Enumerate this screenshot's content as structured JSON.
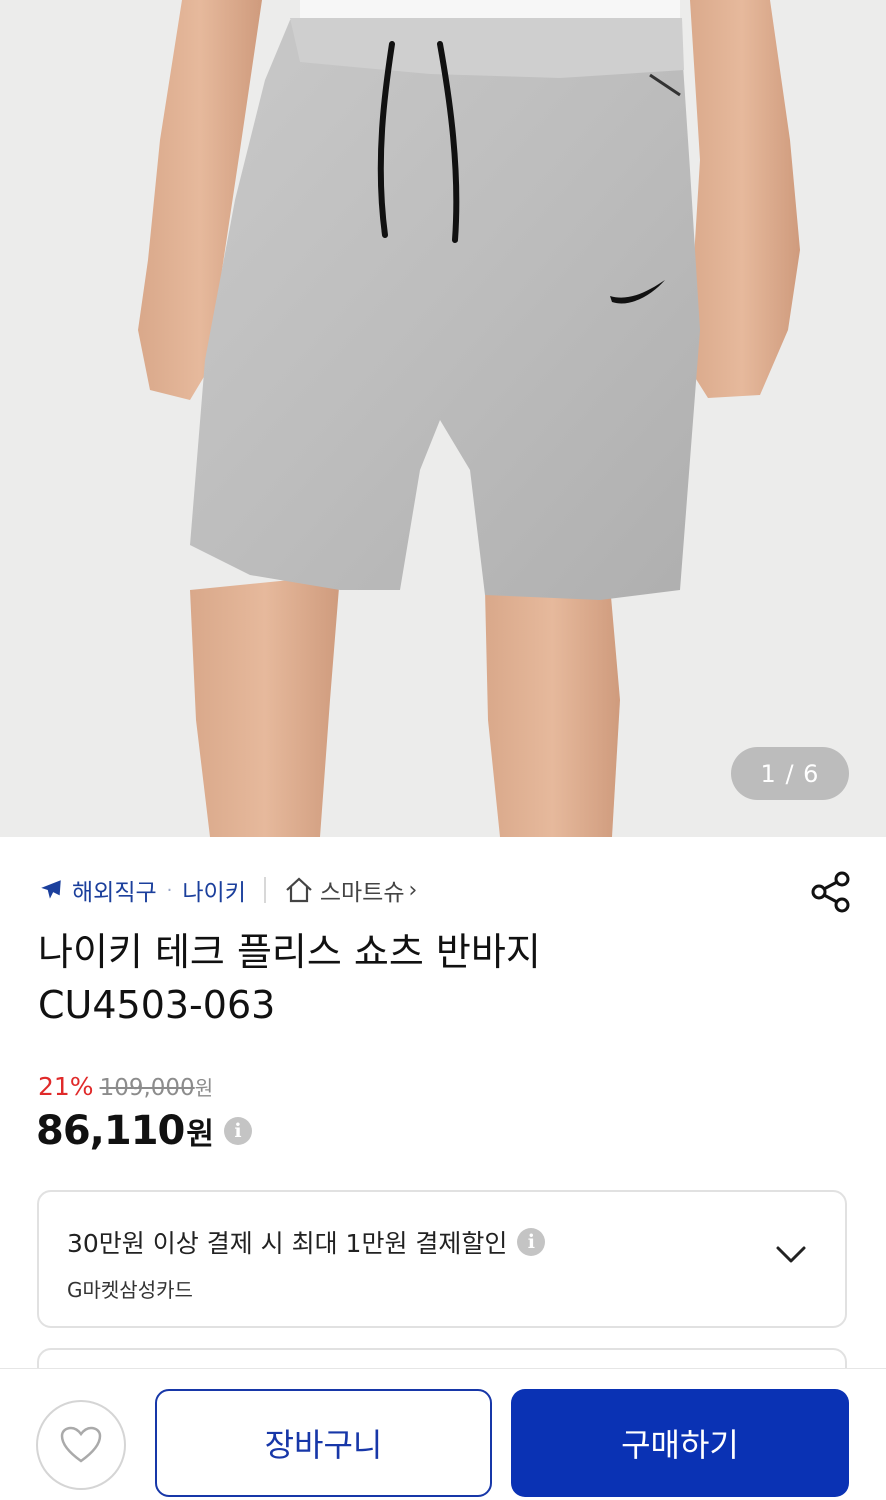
{
  "hero": {
    "counter": "1 / 6",
    "logo_text": "NIKE"
  },
  "breadcrumb": {
    "category": "해외직구",
    "brand": "나이키",
    "shop": "스마트슈",
    "shop_chevron": "›"
  },
  "product": {
    "title_line1": "나이키 테크 플리스 쇼츠 반바지",
    "title_line2": "CU4503-063"
  },
  "price": {
    "discount_rate": "21%",
    "original_price": "109,000",
    "original_unit": "원",
    "sale_price": "86,110",
    "sale_unit": "원",
    "info_glyph": "i"
  },
  "promo": {
    "main_text": "30만원 이상 결제 시 최대 1만원 결제할인",
    "card_name": "G마켓삼성카드",
    "info_glyph": "i"
  },
  "actions": {
    "cart_label": "장바구니",
    "buy_label": "구매하기"
  },
  "colors": {
    "accent_blue": "#0a32b4",
    "link_blue": "#1b3f9c",
    "discount_red": "#e02a2a"
  }
}
